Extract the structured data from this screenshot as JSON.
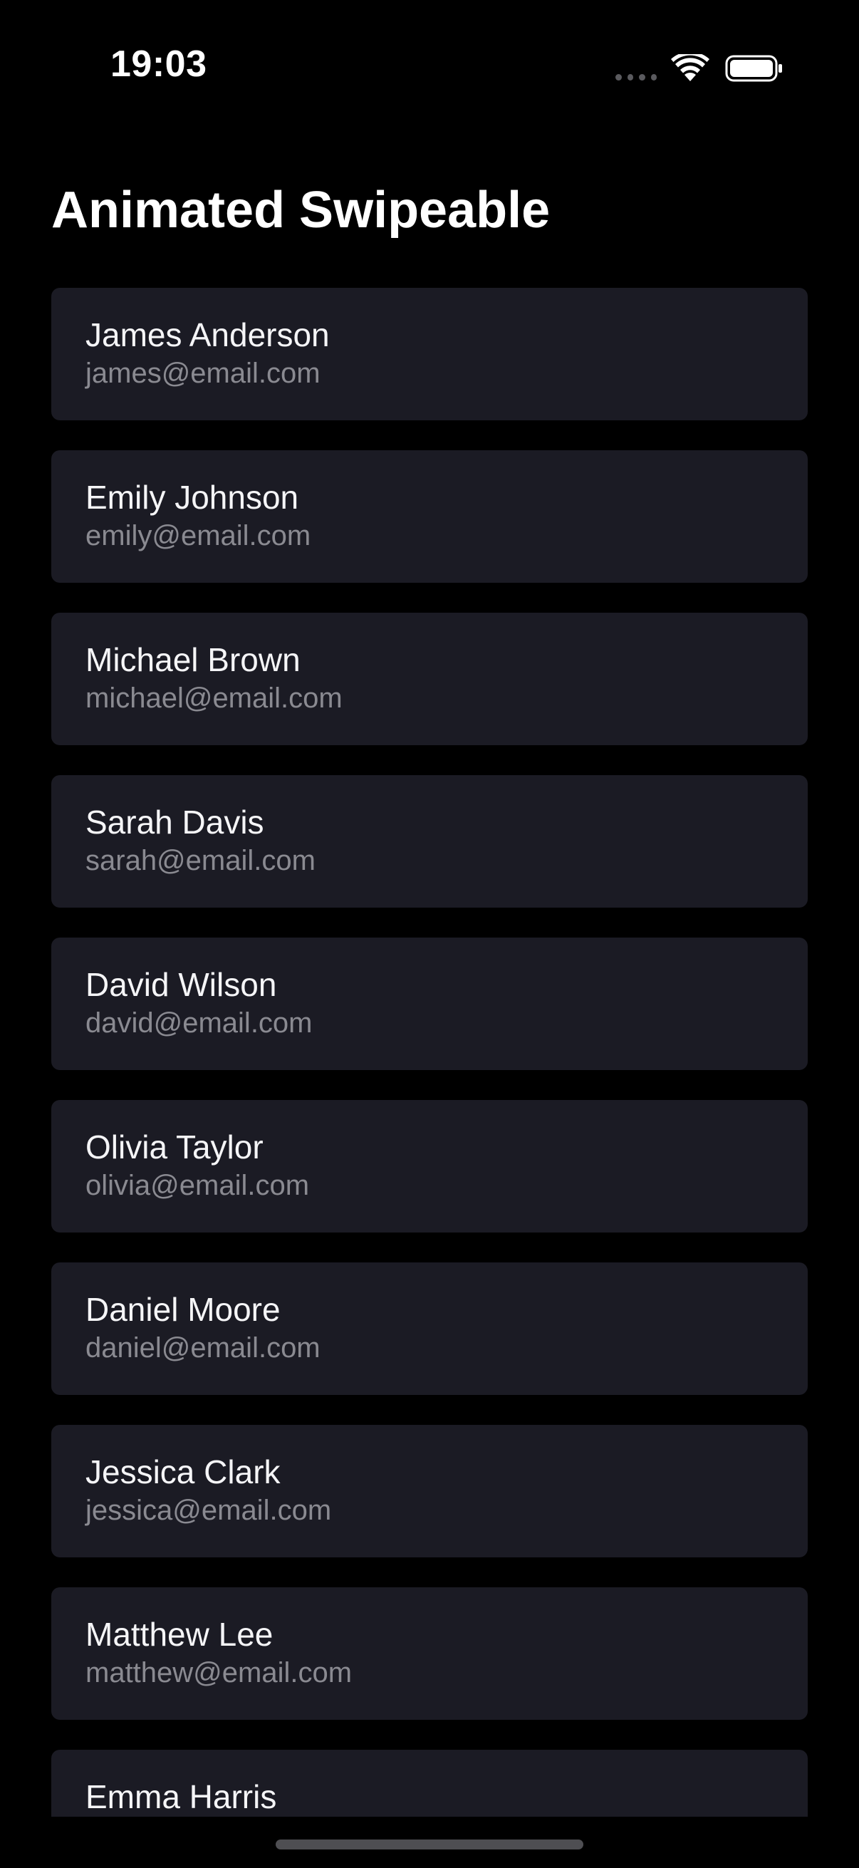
{
  "status_bar": {
    "time": "19:03"
  },
  "header": {
    "title": "Animated Swipeable"
  },
  "contacts": [
    {
      "name": "James Anderson",
      "email": "james@email.com"
    },
    {
      "name": "Emily Johnson",
      "email": "emily@email.com"
    },
    {
      "name": "Michael Brown",
      "email": "michael@email.com"
    },
    {
      "name": "Sarah Davis",
      "email": "sarah@email.com"
    },
    {
      "name": "David Wilson",
      "email": "david@email.com"
    },
    {
      "name": "Olivia Taylor",
      "email": "olivia@email.com"
    },
    {
      "name": "Daniel Moore",
      "email": "daniel@email.com"
    },
    {
      "name": "Jessica Clark",
      "email": "jessica@email.com"
    },
    {
      "name": "Matthew Lee",
      "email": "matthew@email.com"
    },
    {
      "name": "Emma Harris",
      "email": ""
    }
  ],
  "colors": {
    "background": "#000000",
    "card": "#1b1b24",
    "name_text": "#f5f5f7",
    "email_text": "#8a8a91"
  },
  "icons": [
    "signal-icon",
    "wifi-icon",
    "battery-icon"
  ]
}
